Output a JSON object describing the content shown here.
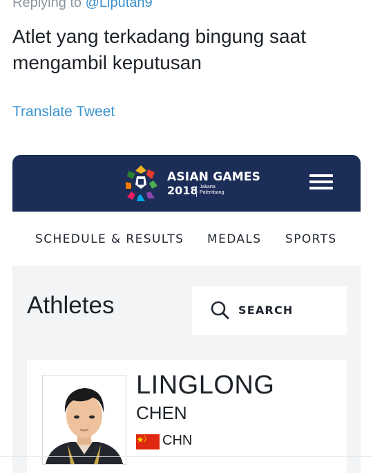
{
  "tweet": {
    "reply_prefix": "Replying to ",
    "reply_handle": "@Liputan9",
    "text": "Atlet yang terkadang bingung saat mengambil keputusan",
    "translate_link": "Translate Tweet"
  },
  "site": {
    "brand_title": "ASIAN GAMES",
    "brand_year": "2018",
    "brand_city": "Jakarta Palembang",
    "menu_icon": "hamburger-menu-icon",
    "header_color": "#1c2d58"
  },
  "nav": {
    "items": [
      "SCHEDULE & RESULTS",
      "MEDALS",
      "SPORTS"
    ]
  },
  "page": {
    "title": "Athletes",
    "search_label": "SEARCH",
    "search_icon": "search-icon"
  },
  "athlete": {
    "first_name": "LINGLONG",
    "last_name": "CHEN",
    "country_code": "CHN",
    "flag_icon": "china-flag-icon"
  }
}
